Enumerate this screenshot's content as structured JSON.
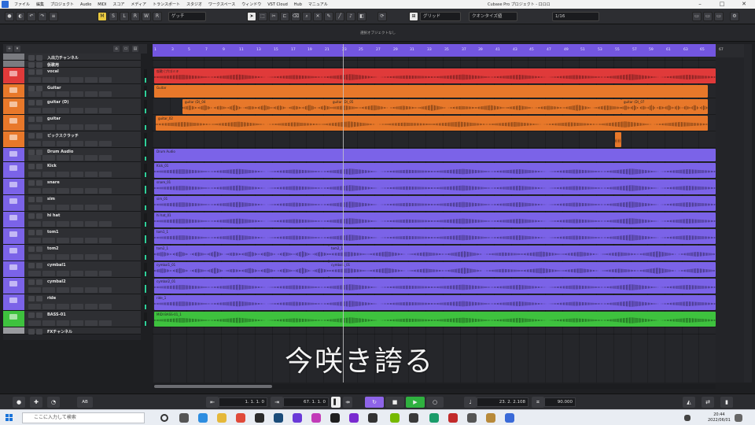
{
  "window": {
    "title": "Cubase Pro プロジェクト - 口ロロ",
    "menu": [
      "ファイル",
      "編集",
      "プロジェクト",
      "Audio",
      "MIDI",
      "スコア",
      "メディア",
      "トランスポート",
      "スタジオ",
      "ワークスペース",
      "ウィンドウ",
      "VST Cloud",
      "Hub",
      "マニュアル"
    ]
  },
  "toolbar": {
    "mode_labels": [
      "M",
      "S",
      "L",
      "R",
      "W",
      "R"
    ],
    "tool_select": "ゲッチ",
    "snap_label": "グリッド",
    "quantize_type": "クオンタイズ値",
    "quantize_value": "1/16"
  },
  "infoline": {
    "message": "選択オブジェクトなし"
  },
  "tracklist": {
    "tracks": [
      {
        "name": "入出力チャンネル",
        "color": "#7a7b80",
        "height": 9
      },
      {
        "name": "仮歌用",
        "color": "#7a7b80",
        "height": 9
      },
      {
        "name": "vocal",
        "color": "#e03a3a",
        "height": 21
      },
      {
        "name": "Guitar",
        "color": "#e8782a",
        "height": 18
      },
      {
        "name": "guitar (D)",
        "color": "#e8782a",
        "height": 21
      },
      {
        "name": "guitar",
        "color": "#e8782a",
        "height": 21
      },
      {
        "name": "ピックスクラッチ",
        "color": "#e8782a",
        "height": 21
      },
      {
        "name": "Drum Audio",
        "color": "#7b63e8",
        "height": 18
      },
      {
        "name": "Kick",
        "color": "#7b63e8",
        "height": 21
      },
      {
        "name": "snare",
        "color": "#7b63e8",
        "height": 21
      },
      {
        "name": "sim",
        "color": "#7b63e8",
        "height": 21
      },
      {
        "name": "hi hat",
        "color": "#7b63e8",
        "height": 21
      },
      {
        "name": "tom1",
        "color": "#7b63e8",
        "height": 21
      },
      {
        "name": "tom2",
        "color": "#7b63e8",
        "height": 21
      },
      {
        "name": "cymbal1",
        "color": "#7b63e8",
        "height": 21
      },
      {
        "name": "cymbal2",
        "color": "#7b63e8",
        "height": 21
      },
      {
        "name": "ride",
        "color": "#7b63e8",
        "height": 21
      },
      {
        "name": "BASS-01",
        "color": "#3ec23e",
        "height": 21
      },
      {
        "name": "FXチャンネル",
        "color": "#9a9ba0",
        "height": 9
      }
    ]
  },
  "ruler": {
    "bars": [
      "1",
      "3",
      "5",
      "7",
      "9",
      "11",
      "13",
      "15",
      "17",
      "19",
      "21",
      "23",
      "25",
      "27",
      "29",
      "31",
      "33",
      "35",
      "37",
      "39",
      "41",
      "43",
      "45",
      "47",
      "49",
      "51",
      "53",
      "55",
      "57",
      "59",
      "61",
      "63",
      "65",
      "67"
    ]
  },
  "events": {
    "vocal": "仮歌 (プロ)ミキ",
    "guitar_folder": "Guitar",
    "guitar_d_1": "guitar (D)_04",
    "guitar_d_2": "guitar (D)_05",
    "guitar_d_3": "guitar (D)_07",
    "guitar_1": "guitar_02",
    "drum_folder": "Drum Audio",
    "kick": "Kick_01",
    "snare": "snare_01",
    "sim": "sim_01",
    "hihat": "hi hat_01",
    "tom1": "tom1_1",
    "tom2_a": "tom2_1",
    "tom2_b": "tom2_1",
    "cymbal1_a": "cymbal1_01",
    "cymbal1_b": "cymbal1_01",
    "cymbal2": "cymbal2_01",
    "ride": "ride_1",
    "bass": "MIDI BASS-01_1"
  },
  "lyric": "今咲き誇る",
  "transport": {
    "left_locator": "1. 1. 1. 0",
    "right_locator": "67. 1. 1. 0",
    "position": "23. 2. 2.108",
    "tempo": "90.000",
    "label_ab": "AB"
  },
  "taskbar": {
    "search_placeholder": "ここに入力して検索",
    "time": "20:44",
    "date": "2022/06/01"
  },
  "colors": {
    "vocal": "#e03a3a",
    "guitar": "#e8782a",
    "drums": "#7b63e8",
    "bass": "#3ec23e",
    "ruler": "#7356e0"
  }
}
